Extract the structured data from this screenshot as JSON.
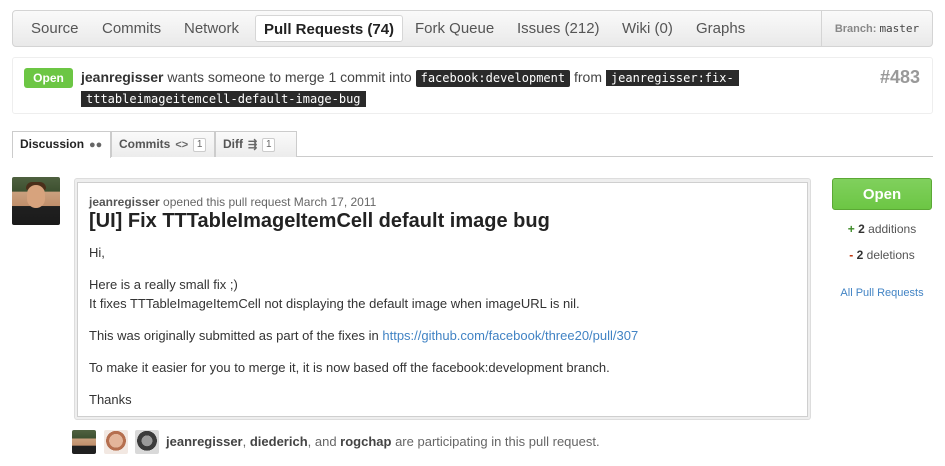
{
  "topnav": {
    "tabs": [
      "Source",
      "Commits",
      "Network",
      "Pull Requests (74)",
      "Fork Queue",
      "Issues (212)",
      "Wiki (0)",
      "Graphs"
    ],
    "selected_index": 3,
    "branch_label": "Branch:",
    "branch_value": "master"
  },
  "pr": {
    "state": "Open",
    "user": "jeanregisser",
    "text_merge": " wants someone to merge 1 commit into ",
    "base_ref": "facebook:development",
    "text_from": " from ",
    "head_ref": "jeanregisser:fix-tttableimageitemcell-default-image-bug",
    "number": "#483"
  },
  "discussion_tabs": [
    {
      "label": "Discussion",
      "icon": "speech-bubbles-icon",
      "icon_glyph": "💬",
      "count": ""
    },
    {
      "label": "Commits",
      "icon": "code-icon",
      "icon_glyph": "<>",
      "count": "1"
    },
    {
      "label": "Diff",
      "icon": "diff-icon",
      "icon_glyph": "⇶",
      "count": "1"
    }
  ],
  "comment": {
    "author": "jeanregisser",
    "meta_text": " opened this pull request March 17, 2011",
    "title": "[UI] Fix TTTableImageItemCell default image bug",
    "greeting": "Hi,",
    "line1": "Here is a really small fix ;)",
    "line2": "It fixes TTTableImageItemCell not displaying the default image when imageURL is nil.",
    "origin_text": "This was originally submitted as part of the fixes in ",
    "origin_link": "https://github.com/facebook/three20/pull/307",
    "merge_note": "To make it easier for you to merge it, it is now based off the facebook:development branch.",
    "closing": "Thanks"
  },
  "sidebar": {
    "state_button": "Open",
    "add_sign": "+",
    "additions_count": "2",
    "additions_label": " additions",
    "del_sign": "-",
    "deletions_count": "2",
    "deletions_label": " deletions",
    "all_prs_link": "All Pull Requests"
  },
  "participants": {
    "users": [
      "jeanregisser",
      "diederich",
      "rogchap"
    ],
    "sep1": ", ",
    "sep2": ", and ",
    "suffix": " are participating in this pull request."
  },
  "colors": {
    "open_green": "#6cc644",
    "link_blue": "#4183c4",
    "ref_bg": "#2a2a2a"
  }
}
